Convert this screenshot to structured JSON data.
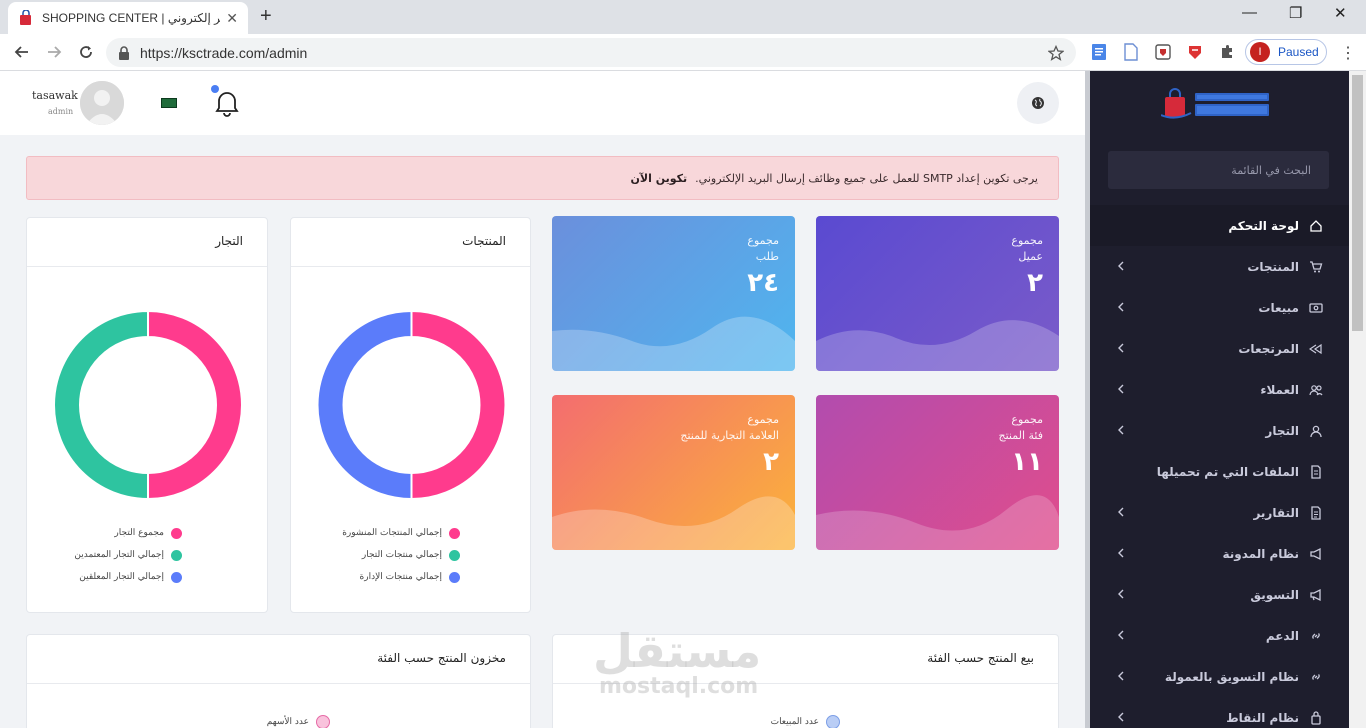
{
  "browser": {
    "tab_title": "SHOPPING CENTER | متجر إلكتروني",
    "tab_close": "✕",
    "new_tab": "+",
    "url": "https://ksctrade.com/admin",
    "profile_initial": "I",
    "profile_status": "Paused",
    "menu": "⋮",
    "window_minimize": "—",
    "window_maximize": "❐",
    "window_close": "✕"
  },
  "header": {
    "user_name": "tasawak",
    "user_role": "admin"
  },
  "alert": {
    "message": "يرجى تكوين إعداد SMTP للعمل على جميع وظائف إرسال البريد الإلكتروني.",
    "action": "تكوين الآن"
  },
  "stats": [
    {
      "line1": "مجموع",
      "line2": "عميل",
      "value": "٢"
    },
    {
      "line1": "مجموع",
      "line2": "طلب",
      "value": "٢٤"
    },
    {
      "line1": "مجموع",
      "line2": "فئة المنتج",
      "value": "١١"
    },
    {
      "line1": "مجموع",
      "line2": "العلامة التجارية للمنتج",
      "value": "٢"
    }
  ],
  "cards": {
    "products": {
      "title": "المنتجات",
      "legend": [
        "إجمالي المنتجات المنشورة",
        "إجمالي منتجات التجار",
        "إجمالي منتجات الإدارة"
      ]
    },
    "merchants": {
      "title": "التجار",
      "legend": [
        "مجموع التجار",
        "إجمالي التجار المعتمدين",
        "إجمالي التجار المعلقين"
      ]
    },
    "sales_by_category": {
      "title": "بيع المنتج حسب الفئة",
      "legend": [
        "عدد المبيعات"
      ]
    },
    "stock_by_category": {
      "title": "مخزون المنتج حسب الفئة",
      "legend": [
        "عدد الأسهم"
      ]
    }
  },
  "chart_data": [
    {
      "type": "pie",
      "title": "المنتجات",
      "categories": [
        "إجمالي المنتجات المنشورة",
        "إجمالي منتجات التجار",
        "إجمالي منتجات الإدارة"
      ],
      "values": [
        50,
        0,
        50
      ],
      "colors": [
        "#ff3b8d",
        "#2ec4a0",
        "#5b7cfa"
      ]
    },
    {
      "type": "pie",
      "title": "التجار",
      "categories": [
        "مجموع التجار",
        "إجمالي التجار المعتمدين",
        "إجمالي التجار المعلقين"
      ],
      "values": [
        50,
        50,
        0
      ],
      "colors": [
        "#ff3b8d",
        "#2ec4a0",
        "#5b7cfa"
      ]
    }
  ],
  "sidebar": {
    "search_placeholder": "البحث في القائمة",
    "items": [
      {
        "label": "لوحة التحكم",
        "icon": "home-icon",
        "active": true,
        "chevron": false
      },
      {
        "label": "المنتجات",
        "icon": "cart-icon",
        "active": false,
        "chevron": true
      },
      {
        "label": "مبيعات",
        "icon": "money-icon",
        "active": false,
        "chevron": true
      },
      {
        "label": "المرتجعات",
        "icon": "return-icon",
        "active": false,
        "chevron": true
      },
      {
        "label": "العملاء",
        "icon": "users-icon",
        "active": false,
        "chevron": true
      },
      {
        "label": "التجار",
        "icon": "user-icon",
        "active": false,
        "chevron": true
      },
      {
        "label": "الملفات التي تم تحميلها",
        "icon": "folder-icon",
        "active": false,
        "chevron": false
      },
      {
        "label": "التقارير",
        "icon": "report-icon",
        "active": false,
        "chevron": true
      },
      {
        "label": "نظام المدونة",
        "icon": "megaphone-icon",
        "active": false,
        "chevron": true
      },
      {
        "label": "التسويق",
        "icon": "bullhorn-icon",
        "active": false,
        "chevron": true
      },
      {
        "label": "الدعم",
        "icon": "link-icon",
        "active": false,
        "chevron": true
      },
      {
        "label": "نظام التسويق بالعمولة",
        "icon": "affiliate-icon",
        "active": false,
        "chevron": true
      },
      {
        "label": "نظام النقاط",
        "icon": "points-icon",
        "active": false,
        "chevron": true
      }
    ]
  },
  "watermark": {
    "arabic": "مستقل",
    "latin": "mostaql.com"
  },
  "colors": {
    "sidebar_bg": "#1e1e2d",
    "accent_pink": "#ff3b8d",
    "accent_teal": "#2ec4a0",
    "accent_blue": "#5b7cfa",
    "alert_bg": "#f8d7da"
  }
}
